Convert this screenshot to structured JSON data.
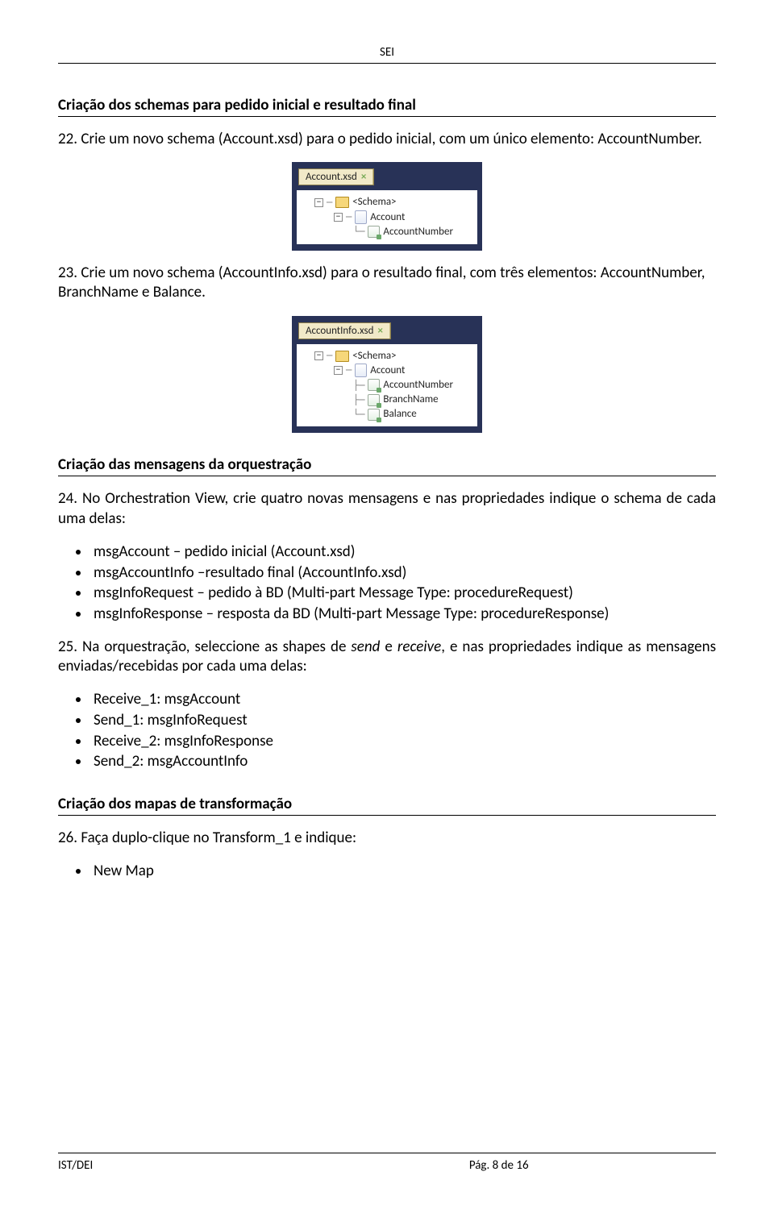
{
  "header": {
    "running": "SEI"
  },
  "sections": {
    "s1": {
      "title": "Criação dos schemas para pedido inicial e resultado final",
      "item22": "22. Crie um novo schema (Account.xsd) para o pedido inicial, com um único elemento: AccountNumber.",
      "item23": "23. Crie um novo schema (AccountInfo.xsd) para o resultado final, com três elementos: AccountNumber, BranchName e Balance."
    },
    "s2": {
      "title": "Criação das mensagens da orquestração",
      "item24_lead": "24. No Orchestration View, crie quatro novas mensagens e nas propriedades indique o schema de cada uma delas:",
      "bullets24": {
        "a": "msgAccount – pedido inicial (Account.xsd)",
        "b": "msgAccountInfo –resultado final (AccountInfo.xsd)",
        "c": "msgInfoRequest – pedido  à BD (Multi-part Message Type: procedureRequest)",
        "d": "msgInfoResponse – resposta da BD (Multi-part Message Type: procedureResponse)"
      },
      "item25_lead_a": "25. Na orquestração, seleccione as shapes de ",
      "item25_lead_send": "send",
      "item25_lead_mid": " e ",
      "item25_lead_recv": "receive",
      "item25_lead_b": ", e nas propriedades indique as mensagens enviadas/recebidas por cada uma delas:",
      "bullets25": {
        "a": "Receive_1: msgAccount",
        "b": "Send_1: msgInfoRequest",
        "c": "Receive_2: msgInfoResponse",
        "d": "Send_2: msgAccountInfo"
      }
    },
    "s3": {
      "title": "Criação dos mapas de transformação",
      "item26_lead": "26. Faça duplo-clique no Transform_1 e indique:",
      "bullets26": {
        "a": "New Map"
      }
    }
  },
  "shot1": {
    "tab": "Account.xsd",
    "tree": {
      "n0": "<Schema>",
      "n1": "Account",
      "n2": "AccountNumber"
    }
  },
  "shot2": {
    "tab": "AccountInfo.xsd",
    "tree": {
      "n0": "<Schema>",
      "n1": "Account",
      "n2": "AccountNumber",
      "n3": "BranchName",
      "n4": "Balance"
    }
  },
  "footer": {
    "left": "IST/DEI",
    "center": "Pág. 8 de 16"
  }
}
